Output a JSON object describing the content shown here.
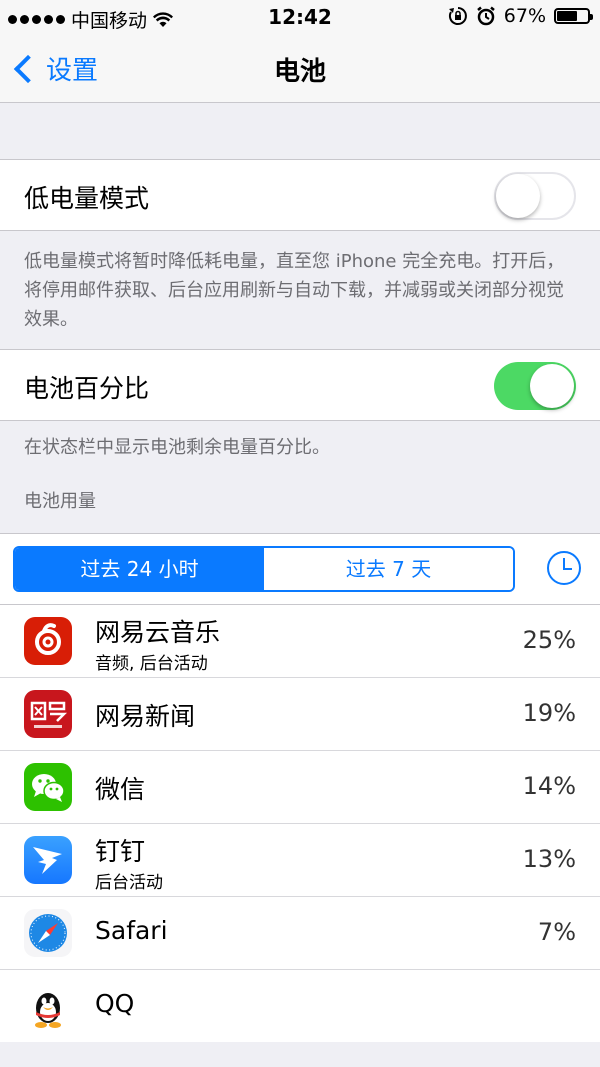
{
  "status_bar": {
    "carrier": "中国移动",
    "time": "12:42",
    "battery_percent_text": "67%",
    "battery_level": 0.67
  },
  "nav": {
    "back_label": "设置",
    "title": "电池"
  },
  "low_power": {
    "label": "低电量模式",
    "enabled": false,
    "description": "低电量模式将暂时降低耗电量，直至您 iPhone 完全充电。打开后，将停用邮件获取、后台应用刷新与自动下载，并减弱或关闭部分视觉效果。"
  },
  "battery_percentage": {
    "label": "电池百分比",
    "enabled": true,
    "description": "在状态栏中显示电池剩余电量百分比。"
  },
  "usage": {
    "header": "电池用量",
    "segments": [
      "过去 24 小时",
      "过去 7 天"
    ],
    "selected_segment": 0,
    "apps": [
      {
        "name": "网易云音乐",
        "subtitle": "音频, 后台活动",
        "percent": "25%",
        "icon": "netease-music-icon"
      },
      {
        "name": "网易新闻",
        "subtitle": "",
        "percent": "19%",
        "icon": "netease-news-icon"
      },
      {
        "name": "微信",
        "subtitle": "",
        "percent": "14%",
        "icon": "wechat-icon"
      },
      {
        "name": "钉钉",
        "subtitle": "后台活动",
        "percent": "13%",
        "icon": "dingtalk-icon"
      },
      {
        "name": "Safari",
        "subtitle": "",
        "percent": "7%",
        "icon": "safari-icon"
      },
      {
        "name": "QQ",
        "subtitle": "",
        "percent": "",
        "icon": "qq-icon"
      }
    ]
  },
  "colors": {
    "accent": "#0a7aff",
    "switch_on": "#4cd964",
    "netease_red": "#d81e06",
    "wechat_green": "#2dc100"
  }
}
